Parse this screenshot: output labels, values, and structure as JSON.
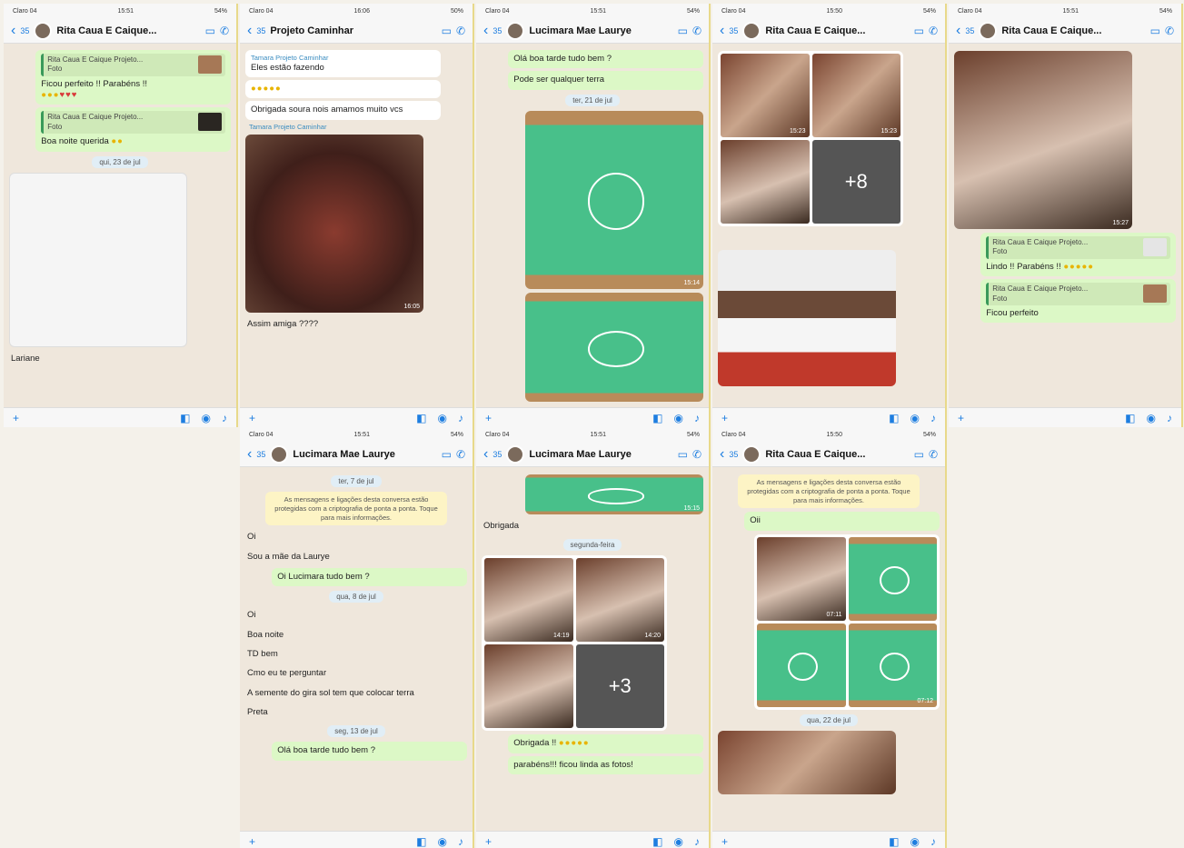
{
  "phones": [
    {
      "status": {
        "carrier": "Claro 04",
        "time": "15:51",
        "battery": "54%"
      },
      "header": {
        "back": "35",
        "contact": "Rita Caua E Caique..."
      },
      "messages": {
        "q1": "Rita Caua E Caique Projeto...",
        "q1b": "Foto",
        "m1": "Ficou perfeito !! Parabéns !!",
        "q2": "Rita Caua E Caique Projeto...",
        "q2b": "Foto",
        "m2": "Boa noite querida",
        "date": "qui, 23 de jul",
        "caption": "Lariane"
      }
    },
    {
      "status": {
        "carrier": "Claro 04",
        "time": "16:06",
        "battery": "50%"
      },
      "header": {
        "back": "35",
        "contact": "Projeto Caminhar"
      },
      "messages": {
        "sender1": "Tamara Projeto Caminhar",
        "m1": "Eles estão fazendo",
        "m3": "Obrigada soura nois amamos muito vcs",
        "sender2": "Tamara Projeto Caminhar",
        "m4": "Assim amiga ????",
        "imgts": "16:05"
      }
    },
    {
      "status": {
        "carrier": "Claro 04",
        "time": "15:51",
        "battery": "54%"
      },
      "header": {
        "back": "35",
        "contact": "Lucimara Mae Laurye"
      },
      "messages": {
        "m1": "Olá boa tarde tudo bem ?",
        "m2": "Pode ser qualquer terra",
        "date": "ter, 21 de jul",
        "imgts": "15:14"
      }
    },
    {
      "status": {
        "carrier": "Claro 04",
        "time": "15:50",
        "battery": "54%"
      },
      "header": {
        "back": "35",
        "contact": "Rita Caua E Caique..."
      },
      "messages": {
        "more": "+8",
        "ts1": "15:23",
        "ts2": "15:23"
      }
    },
    {
      "status": {
        "carrier": "Claro 04",
        "time": "15:51",
        "battery": "54%"
      },
      "header": {
        "back": "35",
        "contact": "Rita Caua E Caique..."
      },
      "messages": {
        "q1": "Rita Caua E Caique Projeto...",
        "q1b": "Foto",
        "m1": "Lindo !! Parabéns !!",
        "q2": "Rita Caua E Caique Projeto...",
        "q2b": "Foto",
        "m2": "Ficou perfeito",
        "imgts": "15:27"
      }
    },
    {
      "status": {
        "carrier": "Claro 04",
        "time": "15:51",
        "battery": "54%"
      },
      "header": {
        "back": "35",
        "contact": "Lucimara Mae Laurye"
      },
      "messages": {
        "date1": "ter, 7 de jul",
        "sys": "As mensagens e ligações desta conversa estão protegidas com a criptografia de ponta a ponta. Toque para mais informações.",
        "m1": "Oi",
        "m2": "Sou a mãe da Laurye",
        "m3": "Oi Lucimara tudo bem ?",
        "date2": "qua, 8 de jul",
        "m4": "Oi",
        "m5": "Boa noite",
        "m6": "TD bem",
        "m7": "Cmo eu te perguntar",
        "m8": "A semente do gira sol tem que colocar terra",
        "m9": "Preta",
        "date3": "seg, 13 de jul",
        "m10": "Olá boa tarde tudo bem ?"
      }
    },
    {
      "status": {
        "carrier": "Claro 04",
        "time": "15:51",
        "battery": "54%"
      },
      "header": {
        "back": "35",
        "contact": "Lucimara Mae Laurye"
      },
      "messages": {
        "m1": "Obrigada",
        "date": "segunda-feira",
        "more": "+3",
        "m2": "Obrigada !!",
        "m3": "parabéns!!! ficou linda as fotos!",
        "ts1": "14:19",
        "ts2": "14:20",
        "ts3": "15:15"
      }
    },
    {
      "status": {
        "carrier": "Claro 04",
        "time": "15:50",
        "battery": "54%"
      },
      "header": {
        "back": "35",
        "contact": "Rita Caua E Caique..."
      },
      "messages": {
        "sys": "As mensagens e ligações desta conversa estão protegidas com a criptografia de ponta a ponta. Toque para mais informações.",
        "m1": "Oii",
        "date": "qua, 22 de jul",
        "ts1": "07:11",
        "ts2": "07:12"
      }
    }
  ]
}
